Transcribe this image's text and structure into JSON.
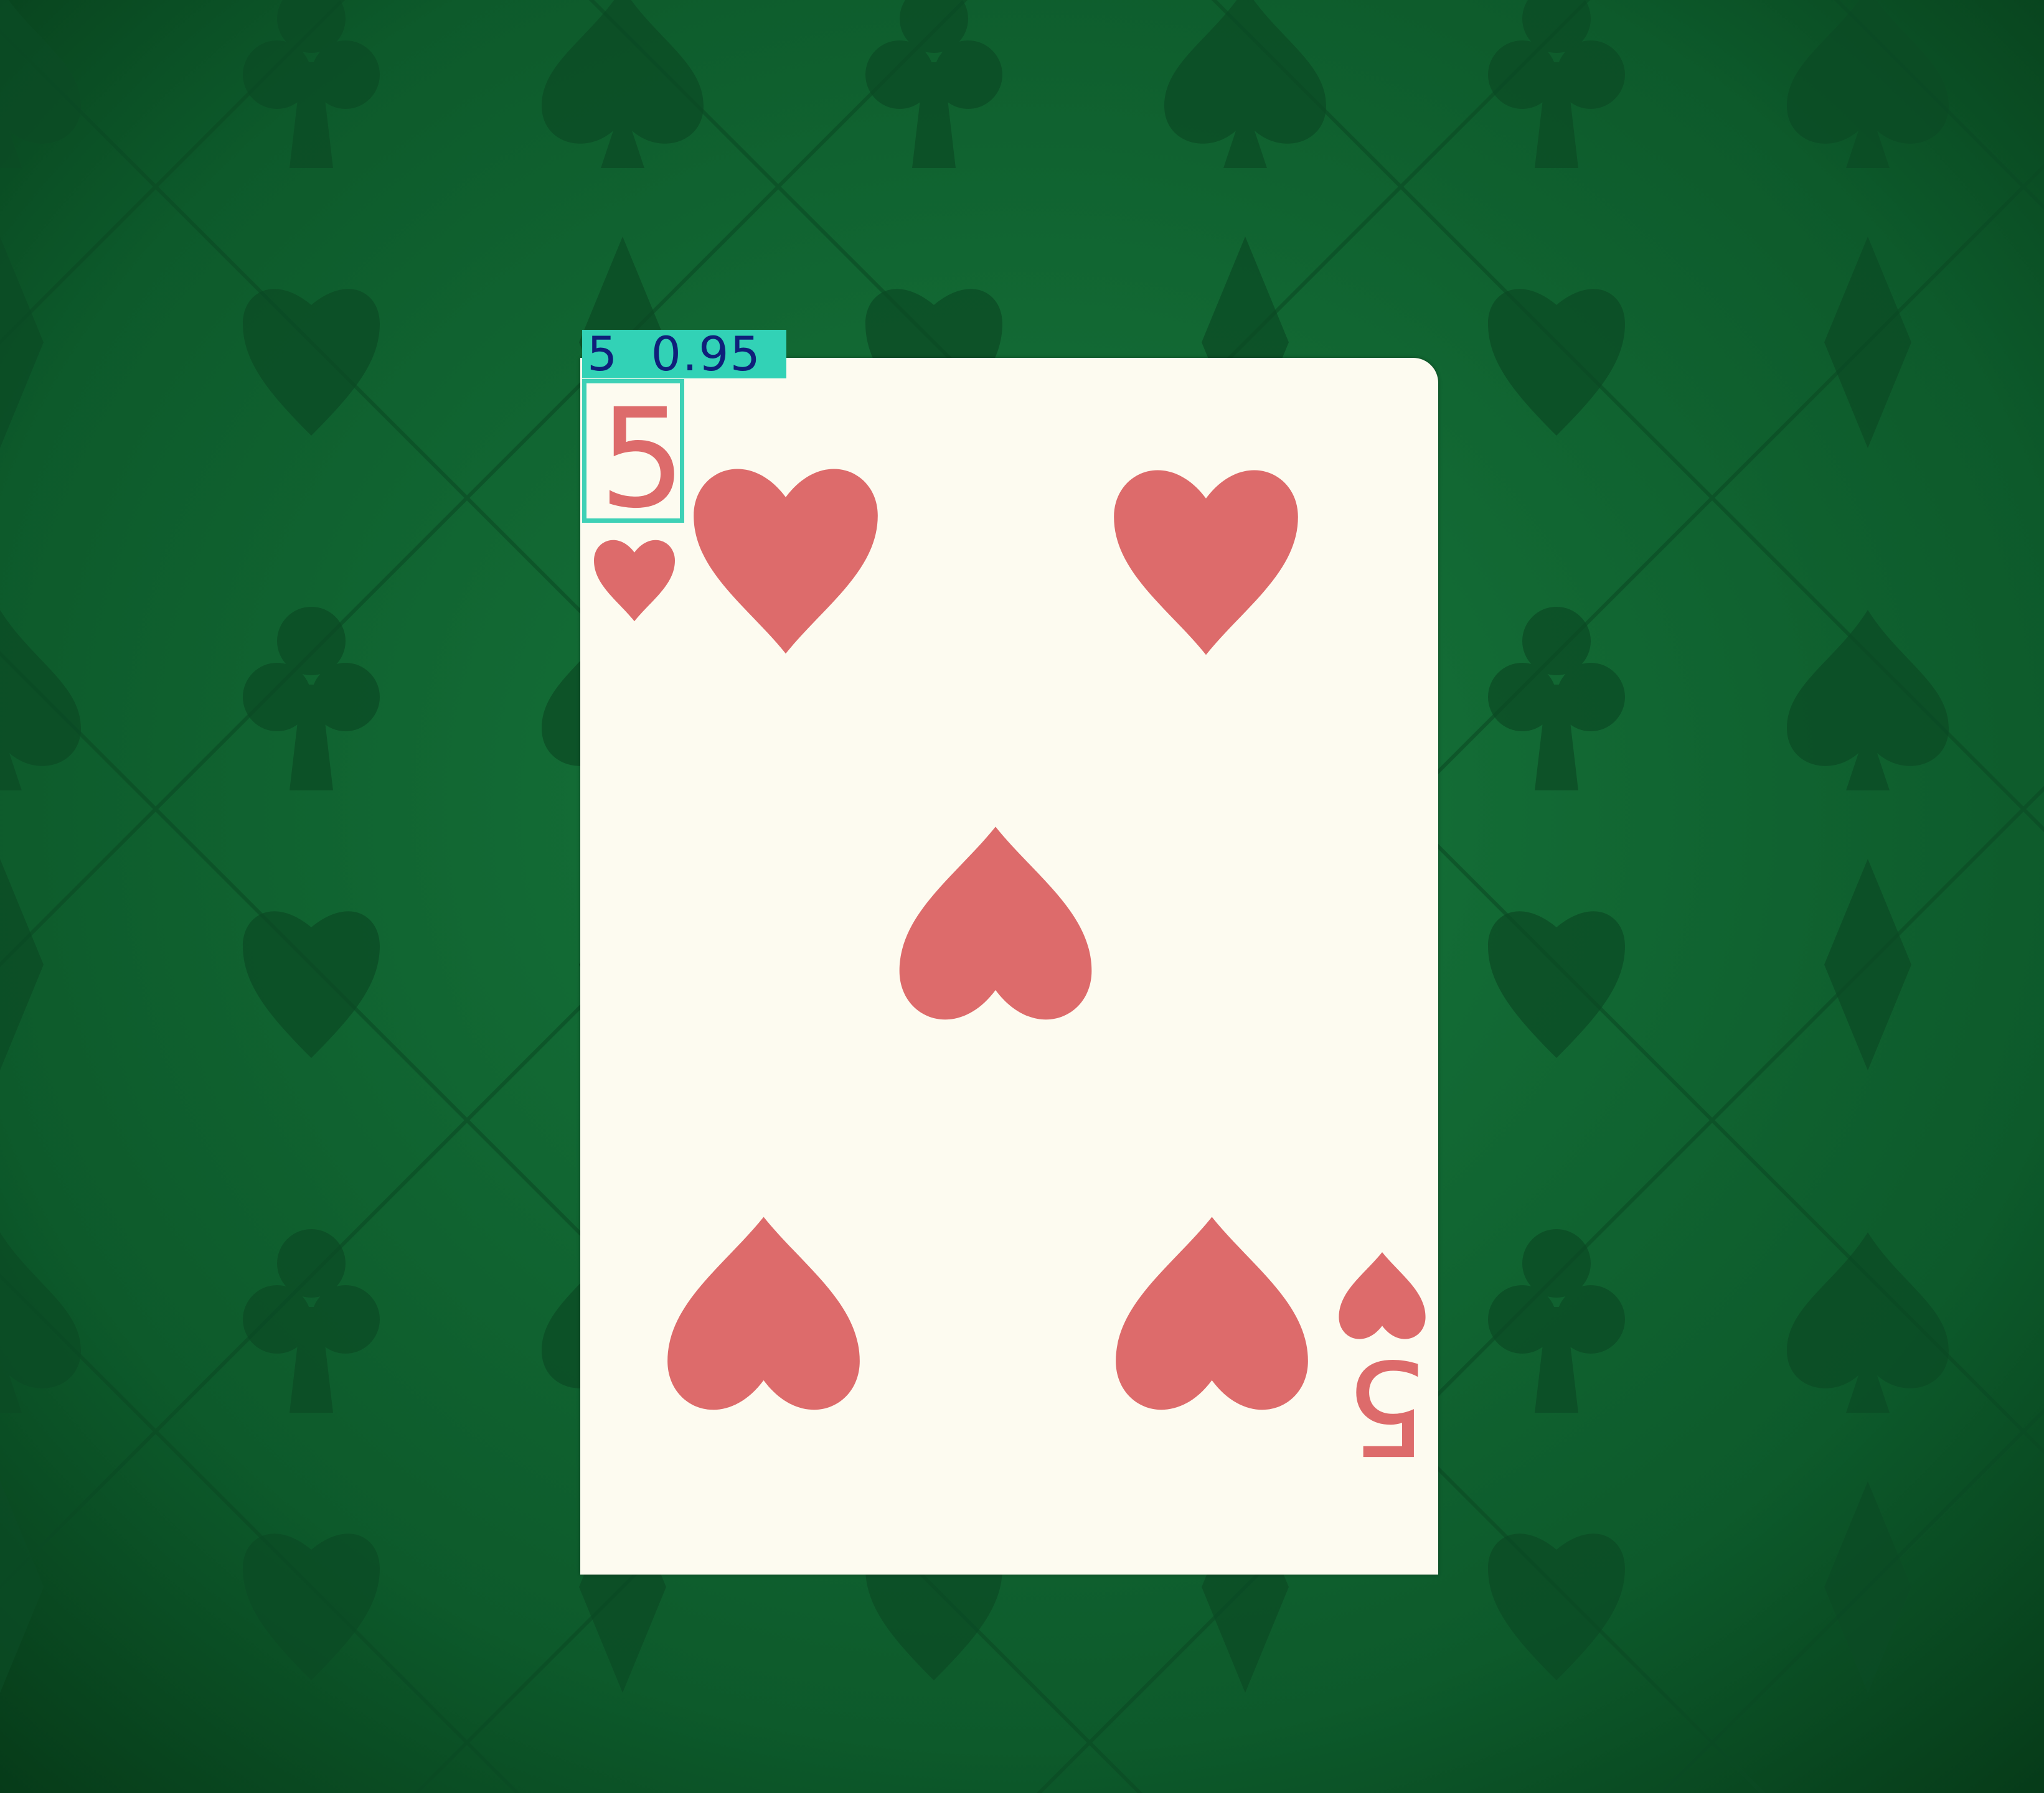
{
  "scene": {
    "background": {
      "pattern": "card-suits",
      "base_color": "#0d5a2b",
      "motif_color": "#0a4a23"
    },
    "card": {
      "rank": "5",
      "suit": "hearts",
      "face_color": "#fdfbf0",
      "pip_color": "#dd6b6b",
      "pip_count": 5
    },
    "detection": {
      "label": "5",
      "confidence": "0.95",
      "text": "5  0.95",
      "box_color": "#3ed1b6",
      "text_color": "#0f1f7a"
    }
  }
}
